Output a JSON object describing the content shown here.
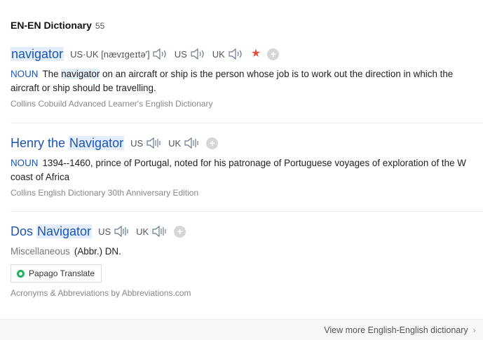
{
  "header": {
    "title": "EN-EN Dictionary",
    "count": "55"
  },
  "entries": [
    {
      "word": "navigator",
      "pronunciation": "US·UK [nævɪgeɪtə']",
      "us_label": "US",
      "uk_label": "UK",
      "pos": "NOUN",
      "def_before": "The ",
      "def_highlight": "navigator",
      "def_after": " on an aircraft or ship is the person whose job is to work out the direction in which the aircraft or ship should be travelling.",
      "source": "Collins Cobuild Advanced Learner's English Dictionary"
    },
    {
      "word_prefix": "Henry the ",
      "word_highlight": "Navigator",
      "us_label": "US",
      "uk_label": "UK",
      "pos": "NOUN",
      "definition": "1394--1460, prince of Portugal, noted for his patronage of Portuguese voyages of exploration of the W coast of Africa",
      "source": "Collins English Dictionary 30th Anniversary Edition"
    },
    {
      "word_prefix": "Dos ",
      "word_highlight": "Navigator",
      "us_label": "US",
      "uk_label": "UK",
      "pos": "Miscellaneous",
      "definition": "(Abbr.) DN.",
      "papago_label": "Papago Translate",
      "source": "Acronyms & Abbreviations by Abbreviations.com"
    }
  ],
  "footer": {
    "more_label": "View more English-English dictionary"
  },
  "colors": {
    "link": "#1a55b8",
    "highlight": "#e4eefb",
    "star": "#e8503c",
    "papago": "#22b05a"
  }
}
